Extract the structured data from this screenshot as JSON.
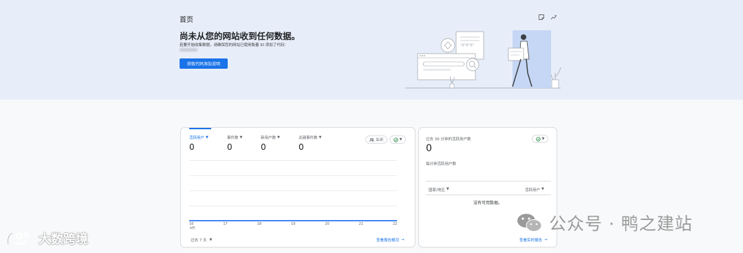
{
  "header": {
    "title": "首页",
    "heading": "尚未从您的网站收到任何数据。",
    "description": "若要开始收集数据，请确保您的网站已使用衡量 ID 添加了代码：",
    "cta_label": "获取代码添加说明"
  },
  "metrics": [
    {
      "label": "活跃用户",
      "value": "0"
    },
    {
      "label": "事件数",
      "value": "0"
    },
    {
      "label": "新用户数",
      "value": "0"
    },
    {
      "label": "关键事件数",
      "value": "0"
    }
  ],
  "compare_label": "关闭",
  "chart_data": {
    "type": "line",
    "x": [
      "16",
      "17",
      "18",
      "19",
      "20",
      "21",
      "22"
    ],
    "x_sub": "8月",
    "series": [
      {
        "name": "活跃用户",
        "values": [
          0,
          0,
          0,
          0,
          0,
          0,
          0
        ]
      }
    ],
    "ylim": [
      0,
      1
    ],
    "grid": true
  },
  "range_label": "过去 7 天",
  "view_report_link": "查看报告概况",
  "realtime": {
    "title": "过去 30 分钟的活跃用户数",
    "value": "0",
    "per_minute": "每分钟活跃用户数",
    "col_country": "国家/地区",
    "col_users": "活跃用户",
    "empty_text": "没有可用数据。",
    "link": "查看实时报告"
  },
  "watermark_right": "公众号 · 鸭之建站",
  "watermark_left": "大数跨境",
  "colors": {
    "accent": "#1a73e8",
    "banner": "#e8eef9",
    "success": "#188038"
  }
}
